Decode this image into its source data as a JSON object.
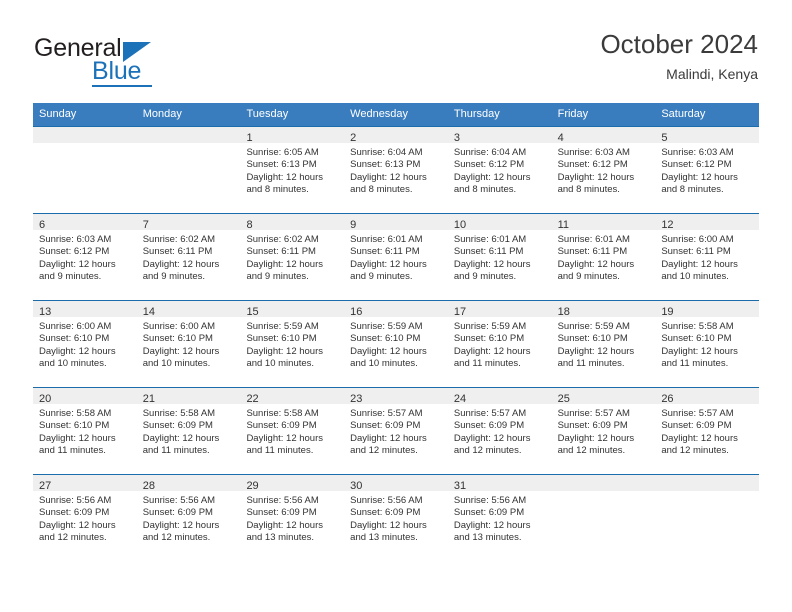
{
  "logo": {
    "word1": "General",
    "word2": "Blue",
    "triangle_color": "#1b72b8"
  },
  "header": {
    "title": "October 2024",
    "location": "Malindi, Kenya"
  },
  "theme": {
    "header_blue": "#3a7dbf",
    "cell_rule_blue": "#1b6cab",
    "day_band_gray": "#efefef"
  },
  "weekdays": [
    "Sunday",
    "Monday",
    "Tuesday",
    "Wednesday",
    "Thursday",
    "Friday",
    "Saturday"
  ],
  "weeks": [
    [
      {
        "day": "",
        "lines": []
      },
      {
        "day": "",
        "lines": []
      },
      {
        "day": "1",
        "lines": [
          "Sunrise: 6:05 AM",
          "Sunset: 6:13 PM",
          "Daylight: 12 hours",
          "and 8 minutes."
        ]
      },
      {
        "day": "2",
        "lines": [
          "Sunrise: 6:04 AM",
          "Sunset: 6:13 PM",
          "Daylight: 12 hours",
          "and 8 minutes."
        ]
      },
      {
        "day": "3",
        "lines": [
          "Sunrise: 6:04 AM",
          "Sunset: 6:12 PM",
          "Daylight: 12 hours",
          "and 8 minutes."
        ]
      },
      {
        "day": "4",
        "lines": [
          "Sunrise: 6:03 AM",
          "Sunset: 6:12 PM",
          "Daylight: 12 hours",
          "and 8 minutes."
        ]
      },
      {
        "day": "5",
        "lines": [
          "Sunrise: 6:03 AM",
          "Sunset: 6:12 PM",
          "Daylight: 12 hours",
          "and 8 minutes."
        ]
      }
    ],
    [
      {
        "day": "6",
        "lines": [
          "Sunrise: 6:03 AM",
          "Sunset: 6:12 PM",
          "Daylight: 12 hours",
          "and 9 minutes."
        ]
      },
      {
        "day": "7",
        "lines": [
          "Sunrise: 6:02 AM",
          "Sunset: 6:11 PM",
          "Daylight: 12 hours",
          "and 9 minutes."
        ]
      },
      {
        "day": "8",
        "lines": [
          "Sunrise: 6:02 AM",
          "Sunset: 6:11 PM",
          "Daylight: 12 hours",
          "and 9 minutes."
        ]
      },
      {
        "day": "9",
        "lines": [
          "Sunrise: 6:01 AM",
          "Sunset: 6:11 PM",
          "Daylight: 12 hours",
          "and 9 minutes."
        ]
      },
      {
        "day": "10",
        "lines": [
          "Sunrise: 6:01 AM",
          "Sunset: 6:11 PM",
          "Daylight: 12 hours",
          "and 9 minutes."
        ]
      },
      {
        "day": "11",
        "lines": [
          "Sunrise: 6:01 AM",
          "Sunset: 6:11 PM",
          "Daylight: 12 hours",
          "and 9 minutes."
        ]
      },
      {
        "day": "12",
        "lines": [
          "Sunrise: 6:00 AM",
          "Sunset: 6:11 PM",
          "Daylight: 12 hours",
          "and 10 minutes."
        ]
      }
    ],
    [
      {
        "day": "13",
        "lines": [
          "Sunrise: 6:00 AM",
          "Sunset: 6:10 PM",
          "Daylight: 12 hours",
          "and 10 minutes."
        ]
      },
      {
        "day": "14",
        "lines": [
          "Sunrise: 6:00 AM",
          "Sunset: 6:10 PM",
          "Daylight: 12 hours",
          "and 10 minutes."
        ]
      },
      {
        "day": "15",
        "lines": [
          "Sunrise: 5:59 AM",
          "Sunset: 6:10 PM",
          "Daylight: 12 hours",
          "and 10 minutes."
        ]
      },
      {
        "day": "16",
        "lines": [
          "Sunrise: 5:59 AM",
          "Sunset: 6:10 PM",
          "Daylight: 12 hours",
          "and 10 minutes."
        ]
      },
      {
        "day": "17",
        "lines": [
          "Sunrise: 5:59 AM",
          "Sunset: 6:10 PM",
          "Daylight: 12 hours",
          "and 11 minutes."
        ]
      },
      {
        "day": "18",
        "lines": [
          "Sunrise: 5:59 AM",
          "Sunset: 6:10 PM",
          "Daylight: 12 hours",
          "and 11 minutes."
        ]
      },
      {
        "day": "19",
        "lines": [
          "Sunrise: 5:58 AM",
          "Sunset: 6:10 PM",
          "Daylight: 12 hours",
          "and 11 minutes."
        ]
      }
    ],
    [
      {
        "day": "20",
        "lines": [
          "Sunrise: 5:58 AM",
          "Sunset: 6:10 PM",
          "Daylight: 12 hours",
          "and 11 minutes."
        ]
      },
      {
        "day": "21",
        "lines": [
          "Sunrise: 5:58 AM",
          "Sunset: 6:09 PM",
          "Daylight: 12 hours",
          "and 11 minutes."
        ]
      },
      {
        "day": "22",
        "lines": [
          "Sunrise: 5:58 AM",
          "Sunset: 6:09 PM",
          "Daylight: 12 hours",
          "and 11 minutes."
        ]
      },
      {
        "day": "23",
        "lines": [
          "Sunrise: 5:57 AM",
          "Sunset: 6:09 PM",
          "Daylight: 12 hours",
          "and 12 minutes."
        ]
      },
      {
        "day": "24",
        "lines": [
          "Sunrise: 5:57 AM",
          "Sunset: 6:09 PM",
          "Daylight: 12 hours",
          "and 12 minutes."
        ]
      },
      {
        "day": "25",
        "lines": [
          "Sunrise: 5:57 AM",
          "Sunset: 6:09 PM",
          "Daylight: 12 hours",
          "and 12 minutes."
        ]
      },
      {
        "day": "26",
        "lines": [
          "Sunrise: 5:57 AM",
          "Sunset: 6:09 PM",
          "Daylight: 12 hours",
          "and 12 minutes."
        ]
      }
    ],
    [
      {
        "day": "27",
        "lines": [
          "Sunrise: 5:56 AM",
          "Sunset: 6:09 PM",
          "Daylight: 12 hours",
          "and 12 minutes."
        ]
      },
      {
        "day": "28",
        "lines": [
          "Sunrise: 5:56 AM",
          "Sunset: 6:09 PM",
          "Daylight: 12 hours",
          "and 12 minutes."
        ]
      },
      {
        "day": "29",
        "lines": [
          "Sunrise: 5:56 AM",
          "Sunset: 6:09 PM",
          "Daylight: 12 hours",
          "and 13 minutes."
        ]
      },
      {
        "day": "30",
        "lines": [
          "Sunrise: 5:56 AM",
          "Sunset: 6:09 PM",
          "Daylight: 12 hours",
          "and 13 minutes."
        ]
      },
      {
        "day": "31",
        "lines": [
          "Sunrise: 5:56 AM",
          "Sunset: 6:09 PM",
          "Daylight: 12 hours",
          "and 13 minutes."
        ]
      },
      {
        "day": "",
        "lines": []
      },
      {
        "day": "",
        "lines": []
      }
    ]
  ]
}
